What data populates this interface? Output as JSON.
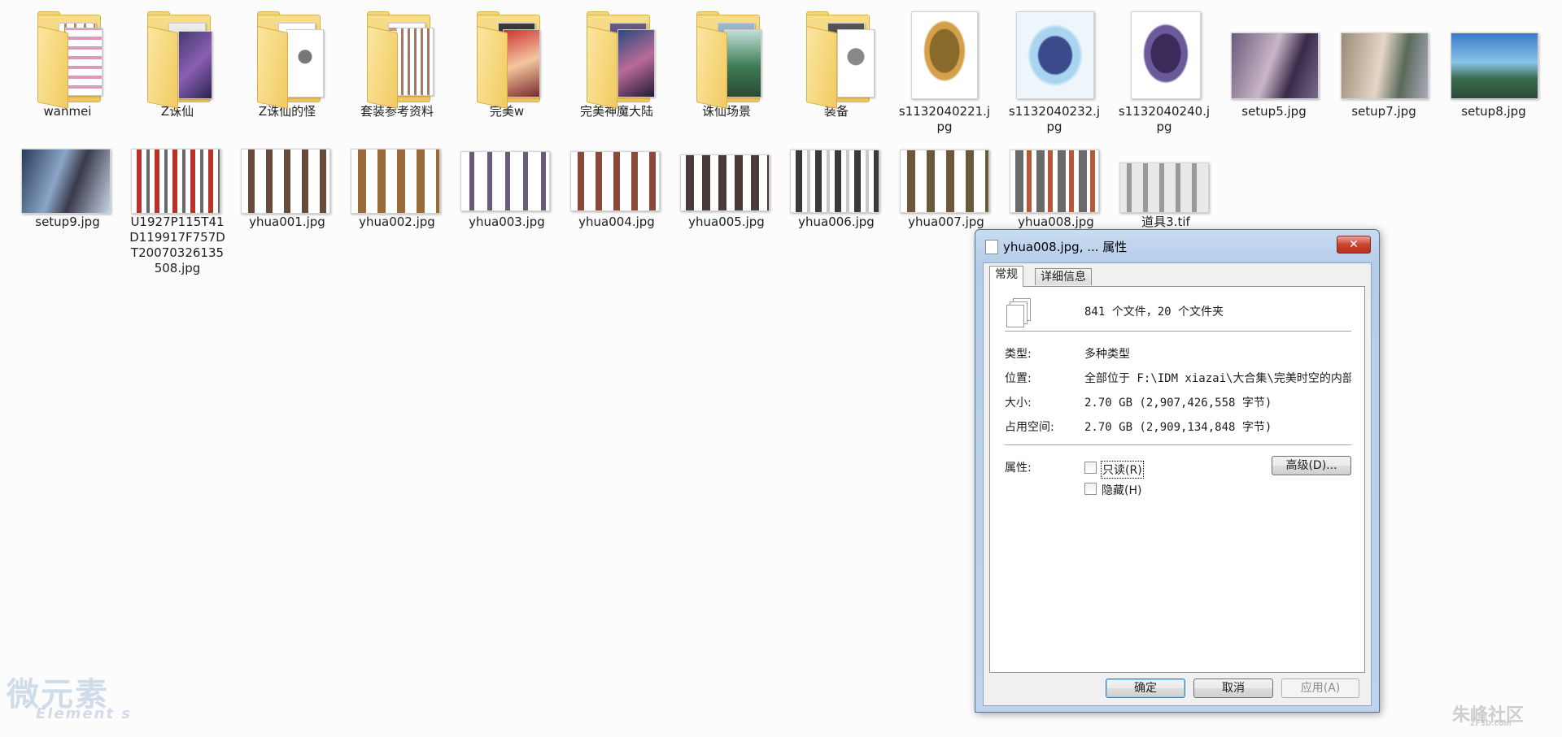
{
  "folders": [
    {
      "label": "wanmei"
    },
    {
      "label": "Z诛仙"
    },
    {
      "label": "Z诛仙的怪"
    },
    {
      "label": "套装参考资料"
    },
    {
      "label": "完美w"
    },
    {
      "label": "完美神魔大陆"
    },
    {
      "label": "诛仙场景"
    },
    {
      "label": "装备"
    }
  ],
  "row1_images": [
    {
      "label": "s1132040221.jpg"
    },
    {
      "label": "s1132040232.jpg"
    },
    {
      "label": "s1132040240.jpg"
    },
    {
      "label": "setup5.jpg"
    },
    {
      "label": "setup7.jpg"
    },
    {
      "label": "setup8.jpg"
    }
  ],
  "row2_images": [
    {
      "label": "setup9.jpg"
    },
    {
      "label": "U1927P115T41D119917F757DT20070326135508.jpg"
    },
    {
      "label": "yhua001.jpg"
    },
    {
      "label": "yhua002.jpg"
    },
    {
      "label": "yhua003.jpg"
    },
    {
      "label": "yhua004.jpg"
    },
    {
      "label": "yhua005.jpg"
    },
    {
      "label": "yhua006.jpg"
    },
    {
      "label": "yhua007.jpg"
    },
    {
      "label": "yhua008.jpg"
    },
    {
      "label": "道具3.tif"
    }
  ],
  "dialog": {
    "title": "yhua008.jpg, ... 属性",
    "close": "✕",
    "tabs": {
      "general": "常规",
      "details": "详细信息"
    },
    "summary": "841 个文件，20 个文件夹",
    "rows": {
      "type_label": "类型:",
      "type_value": "多种类型",
      "location_label": "位置:",
      "location_value": "全部位于 F:\\IDM xiazai\\大合集\\完美时空的内部资料",
      "size_label": "大小:",
      "size_value": "2.70 GB (2,907,426,558 字节)",
      "disk_label": "占用空间:",
      "disk_value": "2.70 GB (2,909,134,848 字节)",
      "attr_label": "属性:"
    },
    "readonly": "只读(R)",
    "hidden": "隐藏(H)",
    "advanced": "高级(D)...",
    "ok": "确定",
    "cancel": "取消",
    "apply": "应用(A)"
  },
  "watermarks": {
    "left": "微元素",
    "left_sub": "Element s",
    "right": "朱峰社区",
    "right_sub": "ZF3D.com"
  }
}
